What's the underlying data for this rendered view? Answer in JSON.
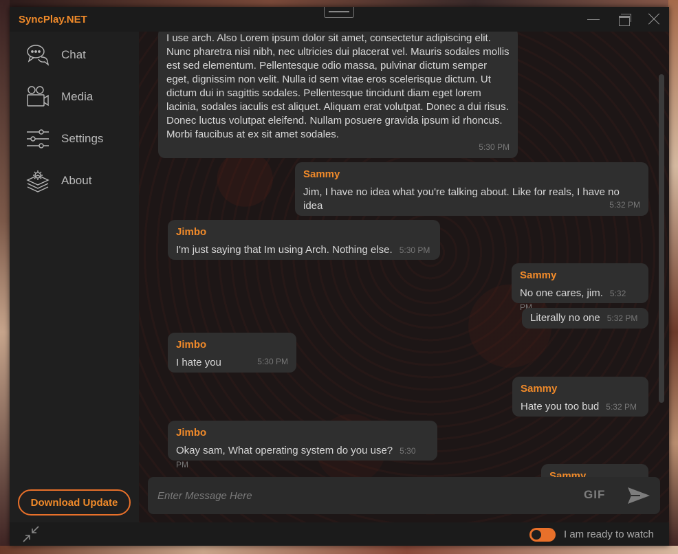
{
  "app": {
    "title": "SyncPlay.NET"
  },
  "sidebar": {
    "items": [
      {
        "label": "Chat",
        "icon": "chat-icon"
      },
      {
        "label": "Media",
        "icon": "camera-icon"
      },
      {
        "label": "Settings",
        "icon": "sliders-icon"
      },
      {
        "label": "About",
        "icon": "layers-gear-icon"
      }
    ],
    "download_label": "Download Update"
  },
  "messages": [
    {
      "author": "",
      "text": "I use arch. Also Lorem ipsum dolor sit amet, consectetur adipiscing elit. Nunc pharetra nisi nibh, nec ultricies dui placerat vel. Mauris sodales mollis est sed elementum. Pellentesque odio massa, pulvinar dictum semper eget, dignissim non velit. Nulla id sem vitae eros scelerisque dictum. Ut dictum dui in sagittis sodales. Pellentesque tincidunt diam eget lorem lacinia, sodales iaculis est aliquet. Aliquam erat volutpat. Donec a dui risus. Donec luctus volutpat eleifend. Nullam posuere gravida ipsum id rhoncus. Morbi faucibus at ex sit amet sodales.",
      "time": "5:30 PM"
    },
    {
      "author": "Sammy",
      "text": "Jim, I have no idea what you're talking about. Like for reals, I have no idea",
      "time": "5:32 PM"
    },
    {
      "author": "Jimbo",
      "text": "I'm just saying that Im using Arch. Nothing else.",
      "time": "5:30 PM"
    },
    {
      "author": "Sammy",
      "text": "No one cares, jim.",
      "time": "5:32 PM"
    },
    {
      "author": "",
      "text": "Literally no one",
      "time": "5:32 PM"
    },
    {
      "author": "Jimbo",
      "text": "I hate you",
      "time": "5:30 PM"
    },
    {
      "author": "Sammy",
      "text": "Hate you too bud",
      "time": "5:32 PM"
    },
    {
      "author": "Jimbo",
      "text": "Okay sam, What operating system do you use?",
      "time": "5:30 PM"
    },
    {
      "author": "Sammy",
      "text": "",
      "time": ""
    }
  ],
  "composer": {
    "placeholder": "Enter Message Here",
    "gif_label": "GIF"
  },
  "footer": {
    "ready_label": "I am ready to watch",
    "ready_on": true
  },
  "colors": {
    "accent": "#f08a2a",
    "bubble": "#2f2f2f",
    "background": "#1e1e1e"
  }
}
